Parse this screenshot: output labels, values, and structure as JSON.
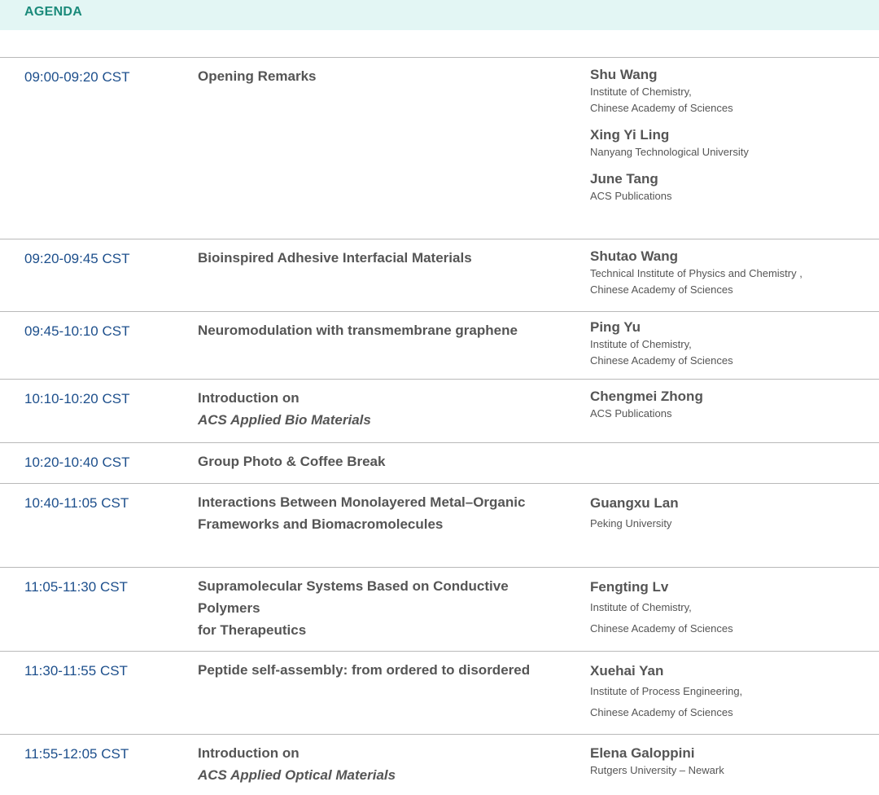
{
  "header": {
    "title": "AGENDA"
  },
  "rows": [
    {
      "time": "09:00-09:20 CST",
      "session": [
        "Opening Remarks"
      ],
      "speakers": [
        {
          "name": "Shu Wang",
          "aff": [
            "Institute of Chemistry,",
            "Chinese Academy of Sciences"
          ]
        },
        {
          "name": "Xing Yi Ling",
          "aff": [
            "Nanyang Technological University"
          ]
        },
        {
          "name": "June Tang",
          "aff": [
            "ACS Publications"
          ]
        }
      ]
    },
    {
      "time": "09:20-09:45 CST",
      "session": [
        "Bioinspired Adhesive Interfacial Materials"
      ],
      "speakers": [
        {
          "name": "Shutao Wang",
          "aff": [
            "Technical Institute of Physics and Chemistry ,",
            "Chinese Academy of Sciences"
          ]
        }
      ]
    },
    {
      "time": "09:45-10:10 CST",
      "session": [
        "Neuromodulation with transmembrane graphene"
      ],
      "speakers": [
        {
          "name": "Ping Yu",
          "aff": [
            "Institute of Chemistry,",
            "Chinese Academy of Sciences"
          ]
        }
      ]
    },
    {
      "time": "10:10-10:20 CST",
      "session": [
        "Introduction on",
        "ACS Applied Bio Materials"
      ],
      "speakers": [
        {
          "name": "Chengmei Zhong",
          "aff": [
            "ACS Publications"
          ]
        }
      ]
    },
    {
      "time": "10:20-10:40 CST",
      "session": [
        "Group Photo & Coffee Break"
      ],
      "speakers": []
    },
    {
      "time": "10:40-11:05 CST",
      "session": [
        "Interactions Between Monolayered Metal–Organic",
        "Frameworks and Biomacromolecules"
      ],
      "speakers": [
        {
          "name": "Guangxu Lan",
          "aff": [
            "Peking University"
          ]
        }
      ]
    },
    {
      "time": "11:05-11:30 CST",
      "session": [
        "Supramolecular Systems Based on Conductive Polymers",
        "for Therapeutics"
      ],
      "speakers": [
        {
          "name": "Fengting Lv",
          "aff": [
            "Institute of Chemistry,",
            "Chinese Academy of Sciences"
          ]
        }
      ]
    },
    {
      "time": "11:30-11:55 CST",
      "session": [
        "Peptide self-assembly: from ordered to disordered"
      ],
      "speakers": [
        {
          "name": "Xuehai Yan",
          "aff": [
            "Institute of Process Engineering,",
            "Chinese Academy of Sciences"
          ]
        }
      ]
    },
    {
      "time": "11:55-12:05 CST",
      "session": [
        "Introduction on",
        "ACS Applied Optical Materials"
      ],
      "speakers": [
        {
          "name": "Elena Galoppini",
          "aff": [
            "Rutgers University – Newark"
          ]
        }
      ]
    }
  ]
}
